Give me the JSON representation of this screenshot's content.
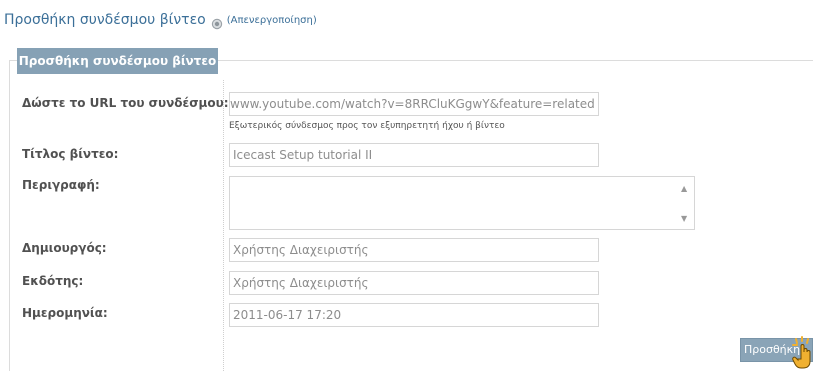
{
  "header": {
    "title": "Προσθήκη συνδέσμου βίντεο",
    "toggle_label": "(Απενεργοποίηση)"
  },
  "form": {
    "panel_title": "Προσθήκη συνδέσμου βίντεο",
    "url": {
      "label": "Δώστε το URL του συνδέσμου:",
      "value": "www.youtube.com/watch?v=8RRCluKGgwY&feature=related",
      "hint": "Εξωτερικός σύνδεσμος προς τον εξυπηρετητή ήχου ή βίντεο"
    },
    "title": {
      "label": "Τίτλος βίντεο:",
      "value": "Icecast Setup tutorial II"
    },
    "description": {
      "label": "Περιγραφή:",
      "value": ""
    },
    "creator": {
      "label": "Δημιουργός:",
      "value": "Χρήστης Διαχειριστής"
    },
    "publisher": {
      "label": "Εκδότης:",
      "value": "Χρήστης Διαχειριστής"
    },
    "date": {
      "label": "Ημερομηνία:",
      "value": "2011-06-17 17:20"
    },
    "submit_label": "Προσθήκη"
  },
  "icons": {
    "disable": "disable-icon",
    "cursor": "hand-cursor-icon"
  },
  "colors": {
    "accent": "#3b6f98",
    "tab_background": "#86a1b5",
    "button_background": "#8aa4b7"
  }
}
